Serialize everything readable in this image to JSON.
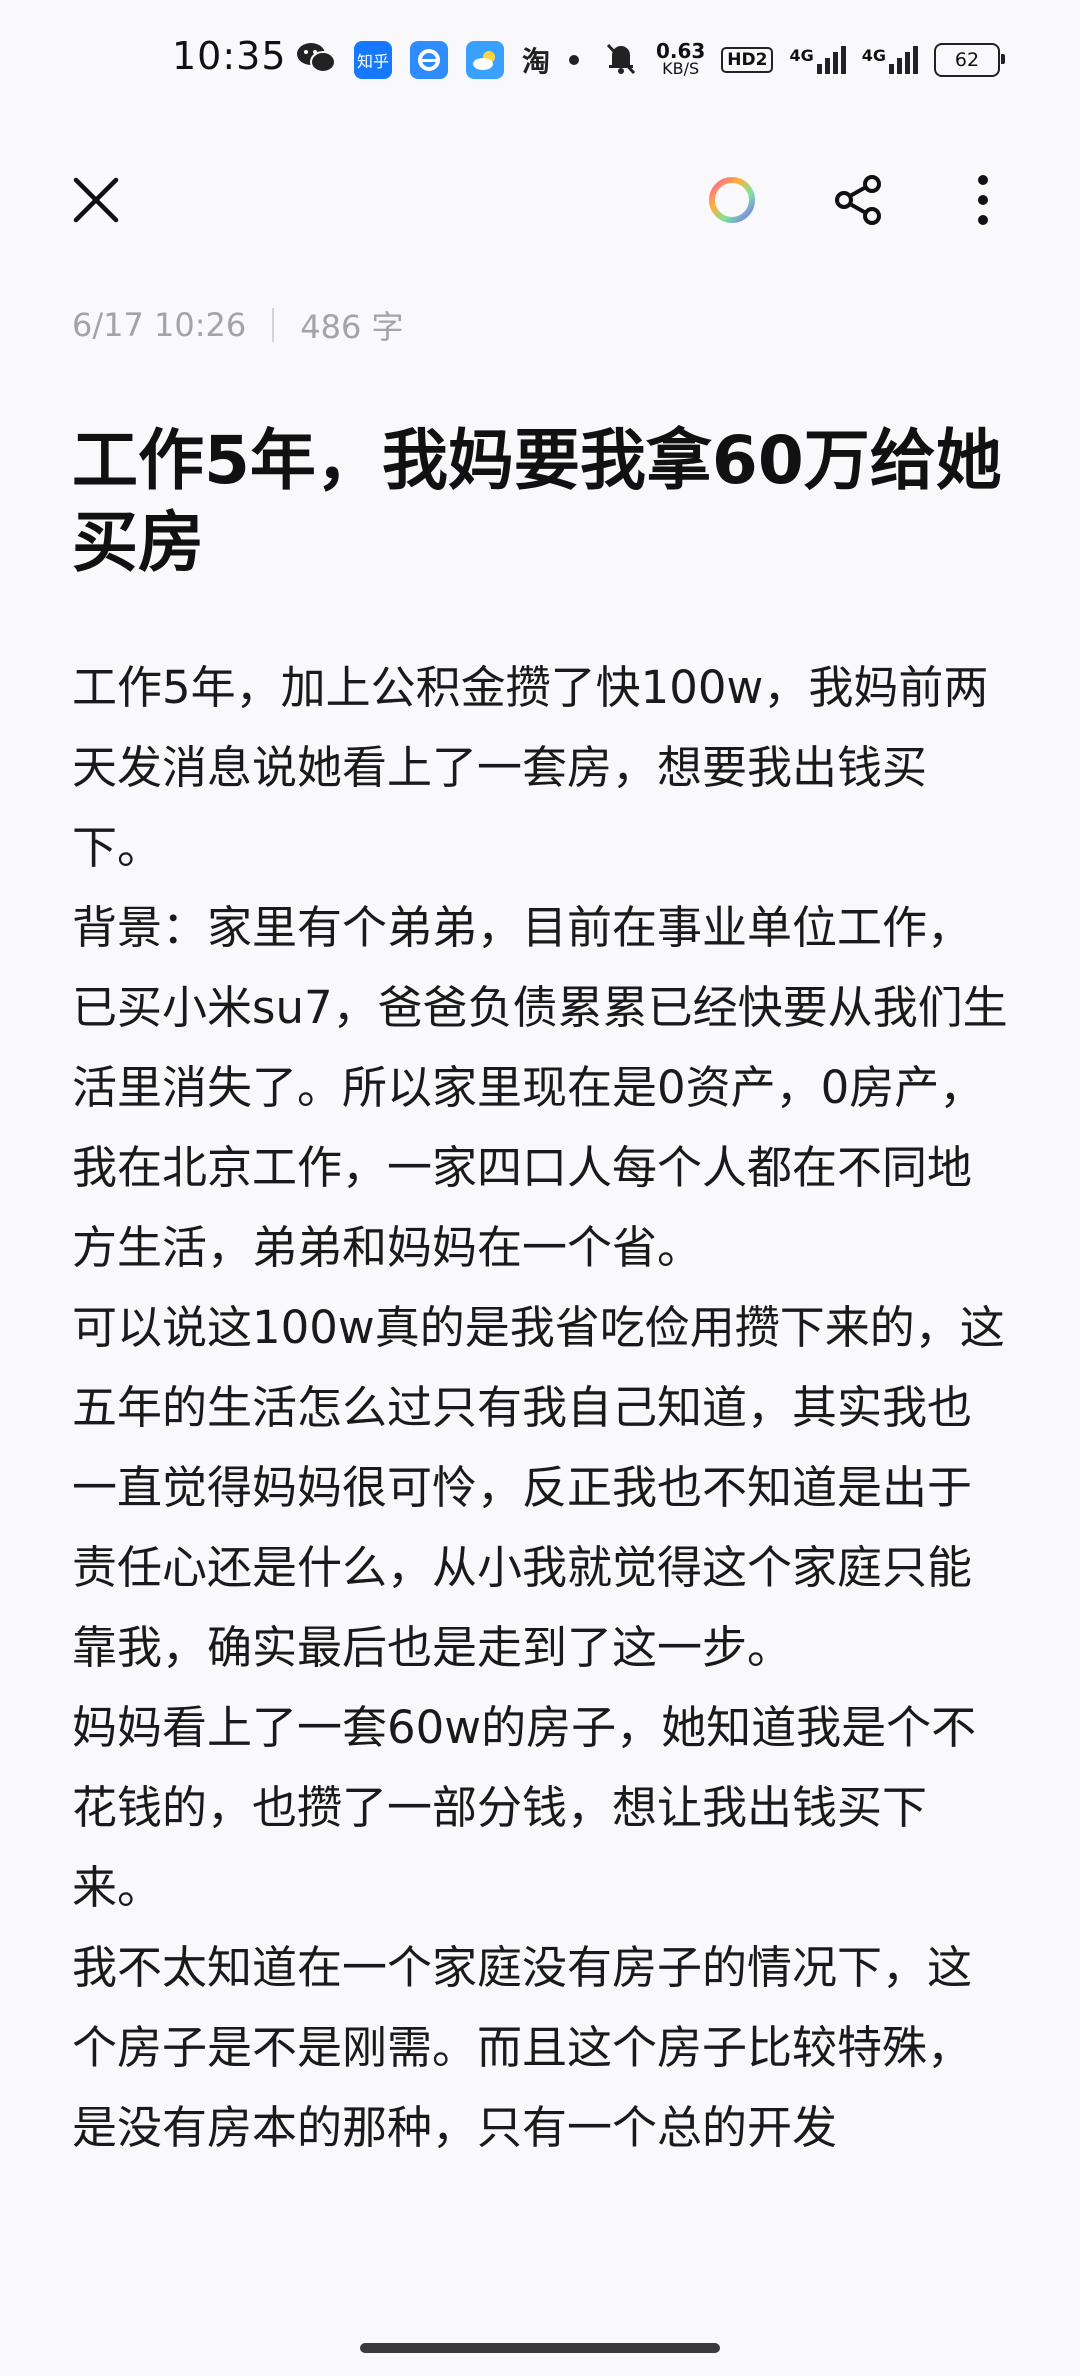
{
  "status_bar": {
    "time": "10:35",
    "net_speed_value": "0.63",
    "net_speed_unit": "KB/S",
    "hd_label": "HD2",
    "signal1_label": "4G",
    "signal2_label": "4G",
    "battery_level": "62",
    "icons": [
      "wechat-icon",
      "zhihu-icon",
      "browser-icon",
      "weather-icon",
      "taobao-icon",
      "dot-icon",
      "mute-icon"
    ],
    "zhihu_text": "知乎",
    "taobao_text": "淘"
  },
  "toolbar": {
    "icons": [
      "close-icon",
      "color-ring-icon",
      "share-icon",
      "more-icon"
    ]
  },
  "meta": {
    "datetime": "6/17 10:26",
    "word_count": "486 字"
  },
  "article": {
    "title": "工作5年，我妈要我拿60万给她买房",
    "paragraphs": [
      "工作5年，加上公积金攒了快100w，我妈前两天发消息说她看上了一套房，想要我出钱买下。",
      "背景：家里有个弟弟，目前在事业单位工作，已买小米su7，爸爸负债累累已经快要从我们生活里消失了。所以家里现在是0资产，0房产，我在北京工作，一家四口人每个人都在不同地方生活，弟弟和妈妈在一个省。",
      "可以说这100w真的是我省吃俭用攒下来的，这五年的生活怎么过只有我自己知道，其实我也一直觉得妈妈很可怜，反正我也不知道是出于责任心还是什么，从小我就觉得这个家庭只能靠我，确实最后也是走到了这一步。",
      "妈妈看上了一套60w的房子，她知道我是个不花钱的，也攒了一部分钱，想让我出钱买下来。",
      "我不太知道在一个家庭没有房子的情况下，这个房子是不是刚需。而且这个房子比较特殊，是没有房本的那种，只有一个总的开发"
    ]
  }
}
